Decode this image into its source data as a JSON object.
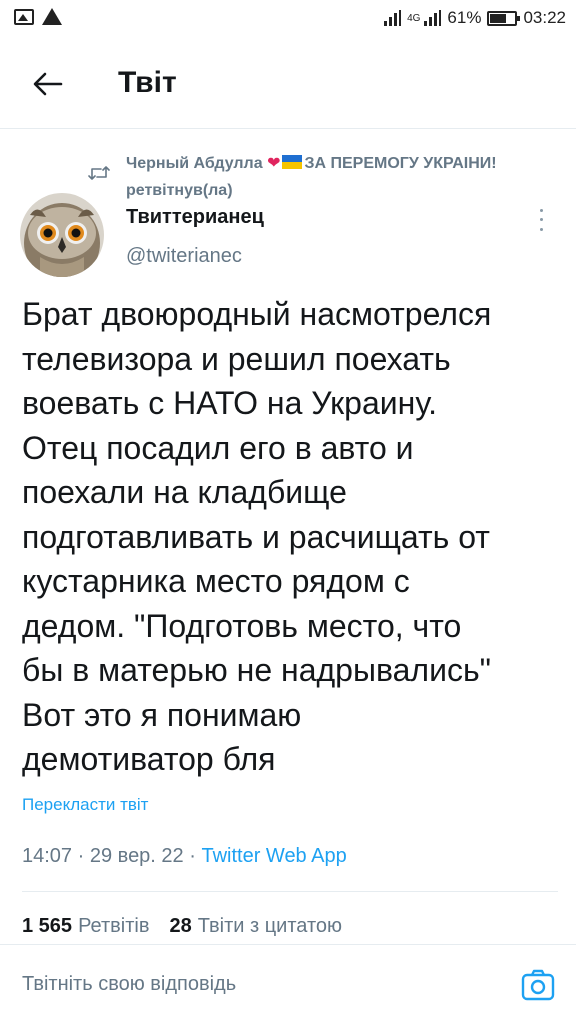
{
  "status_bar": {
    "network": "4G",
    "battery": "61%",
    "time": "03:22"
  },
  "header": {
    "title": "Твіт"
  },
  "retweet_context": {
    "name_part": "Черный Абдулла",
    "slogan": "ЗА ПЕРЕМОГУ УКРАІНИ!",
    "suffix": "ретвітнув(ла)"
  },
  "author": {
    "name": "Твиттерианец",
    "handle": "@twiterianec"
  },
  "tweet": {
    "text": "Брат двоюродный насмотрелся\nтелевизора и решил поехать\nвоевать с НАТО на Украину.\nОтец посадил его в авто и\nпоехали на кладбище\nподготавливать и расчищать от\nкустарника место рядом с\nдедом. \"Подготовь место, что\nбы в матерью не надрывались\"\nВот это я понимаю\nдемотиватор бля",
    "translate_label": "Перекласти твіт",
    "time": "14:07",
    "date": "29 вер. 22",
    "source": "Twitter Web App"
  },
  "stats": {
    "retweets_count": "1 565",
    "retweets_label": "Ретвітів",
    "quotes_count": "28",
    "quotes_label": "Твіти з цитатою"
  },
  "reply": {
    "placeholder": "Твітніть свою відповідь"
  },
  "colors": {
    "accent": "#1da1f2",
    "secondary_text": "#657786",
    "heart": "#e0245e"
  }
}
